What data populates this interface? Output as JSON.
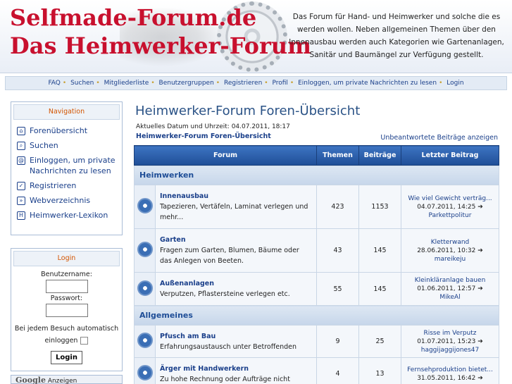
{
  "header": {
    "logo_line1": "Selfmade-Forum.de",
    "logo_line2": "Das Heimwerker-Forum",
    "description": "Das Forum für Hand- und Heimwerker und solche die es werden wollen. Neben allgemeinen Themen über den Innenausbau werden auch Kategorien wie Gartenanlagen, Sanitär und Baumängel zur Verfügung gestellt."
  },
  "topnav": [
    "FAQ",
    "Suchen",
    "Mitgliederliste",
    "Benutzergruppen",
    "Registrieren",
    "Profil",
    "Einloggen, um private Nachrichten zu lesen",
    "Login"
  ],
  "sidebar": {
    "nav_title": "Navigation",
    "items": [
      {
        "label": "Forenübersicht",
        "icon": "home-icon"
      },
      {
        "label": "Suchen",
        "icon": "search-icon"
      },
      {
        "label": "Einloggen, um private Nachrichten zu lesen",
        "icon": "message-icon"
      },
      {
        "label": "Registrieren",
        "icon": "register-icon"
      },
      {
        "label": "Webverzeichnis",
        "icon": "directory-icon"
      },
      {
        "label": "Heimwerker-Lexikon",
        "icon": "lexicon-icon"
      }
    ],
    "login_title": "Login",
    "username_label": "Benutzername:",
    "password_label": "Passwort:",
    "auto_login": "Bei jedem Besuch automatisch einloggen",
    "login_button": "Login",
    "google_text": "Google",
    "google_ads": "Anzeigen"
  },
  "main": {
    "title": "Heimwerker-Forum Foren-Übersicht",
    "date": "Aktuelles Datum und Uhrzeit: 04.07.2011, 18:17",
    "breadcrumb": "Heimwerker-Forum Foren-Übersicht",
    "unanswered": "Unbeantwortete Beiträge anzeigen",
    "columns": [
      "Forum",
      "Themen",
      "Beiträge",
      "Letzter Beitrag"
    ],
    "categories": [
      {
        "name": "Heimwerken",
        "forums": [
          {
            "name": "Innenausbau",
            "desc": "Tapezieren, Vertäfeln, Laminat verlegen und mehr...",
            "topics": "423",
            "posts": "1153",
            "last_title": "Wie viel Gewicht verträg...",
            "last_date": "04.07.2011, 14:25",
            "last_user": "Parkettpolitur"
          },
          {
            "name": "Garten",
            "desc": "Fragen zum Garten, Blumen, Bäume oder das Anlegen von Beeten.",
            "topics": "43",
            "posts": "145",
            "last_title": "Kletterwand",
            "last_date": "28.06.2011, 10:32",
            "last_user": "mareikeju"
          },
          {
            "name": "Außenanlagen",
            "desc": "Verputzen, Pflastersteine verlegen etc.",
            "topics": "55",
            "posts": "145",
            "last_title": "Kleinkläranlage bauen",
            "last_date": "01.06.2011, 12:57",
            "last_user": "MikeAl"
          }
        ]
      },
      {
        "name": "Allgemeines",
        "forums": [
          {
            "name": "Pfusch am Bau",
            "desc": "Erfahrungsaustausch unter Betroffenden",
            "topics": "9",
            "posts": "25",
            "last_title": "Risse im Verputz",
            "last_date": "01.07.2011, 15:23",
            "last_user": "haggijaggijones47"
          },
          {
            "name": "Ärger mit Handwerkern",
            "desc": "Zu hohe Rechnung oder Aufträge nicht",
            "topics": "4",
            "posts": "13",
            "last_title": "Fernsehproduktion bietet...",
            "last_date": "31.05.2011, 16:42",
            "last_user": ""
          }
        ]
      }
    ]
  },
  "colors": {
    "accent": "#1f4e97",
    "logo": "#c8102e",
    "nav_title": "#d35400"
  }
}
